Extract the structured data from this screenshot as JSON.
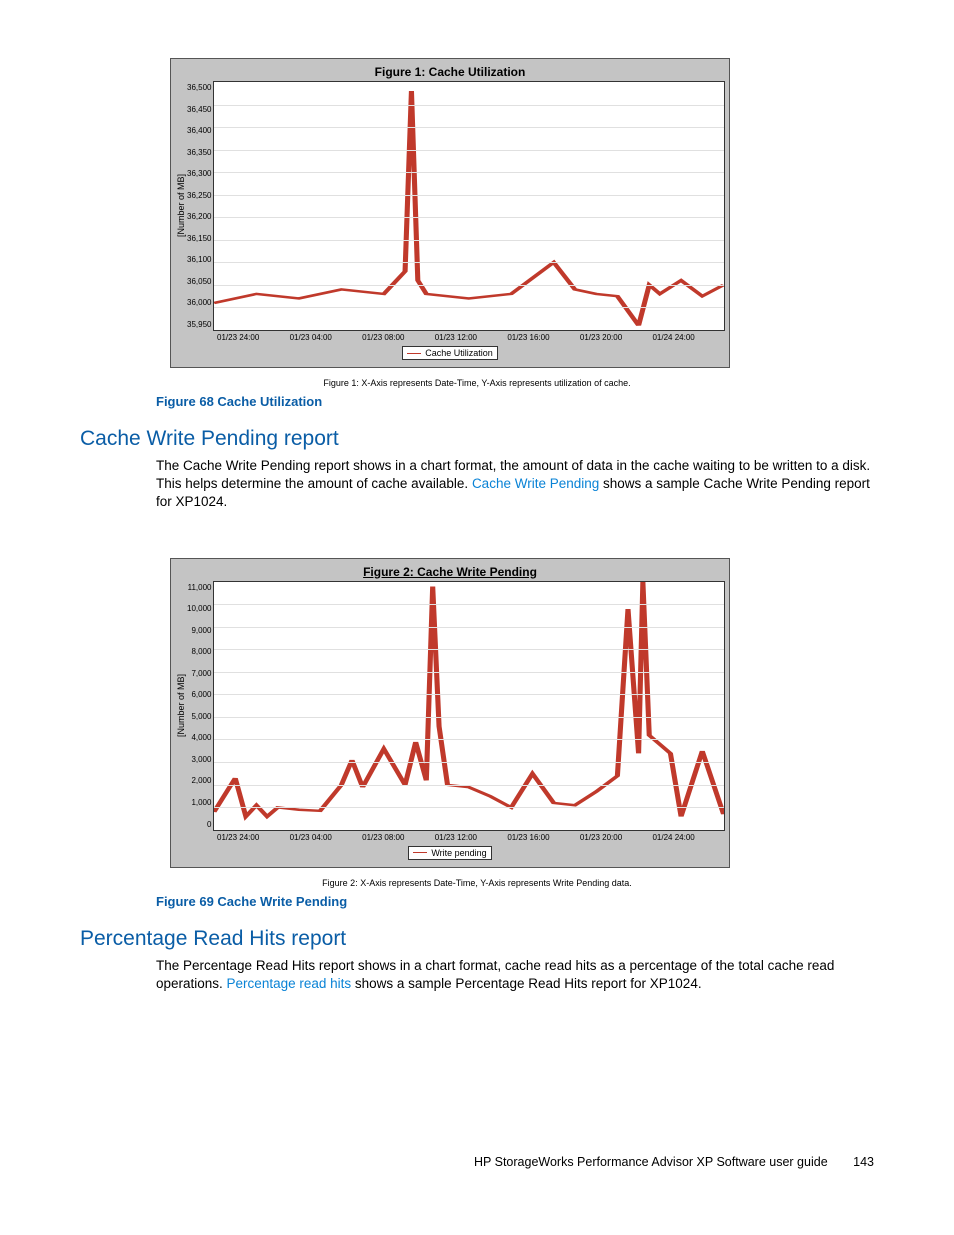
{
  "chart_data": [
    {
      "type": "line",
      "title": "Figure 1: Cache Utilization",
      "ylabel": "[Number of MB]",
      "xlabel": "",
      "ylim": [
        35950,
        36500
      ],
      "xticks": [
        "01/23 24:00",
        "01/23 04:00",
        "01/23 08:00",
        "01/23 12:00",
        "01/23 16:00",
        "01/23 20:00",
        "01/24 24:00"
      ],
      "yticks": [
        "36,500",
        "36,450",
        "36,400",
        "36,350",
        "36,300",
        "36,250",
        "36,200",
        "36,150",
        "36,100",
        "36,050",
        "36,000",
        "35,950"
      ],
      "legend": "Cache Utilization",
      "caption": "Figure 1: X-Axis represents Date-Time, Y-Axis represents utilization of cache.",
      "series": [
        {
          "name": "Cache Utilization",
          "x": [
            0,
            2,
            4,
            6,
            8,
            9,
            9.3,
            9.6,
            10,
            12,
            14,
            16,
            17,
            18,
            19,
            20,
            20.5,
            21,
            22,
            23,
            24
          ],
          "y": [
            36010,
            36030,
            36020,
            36040,
            36030,
            36080,
            36480,
            36060,
            36030,
            36020,
            36030,
            36100,
            36040,
            36030,
            36025,
            35960,
            36050,
            36030,
            36060,
            36025,
            36050
          ]
        }
      ]
    },
    {
      "type": "line",
      "title": "Figure 2: Cache Write Pending",
      "ylabel": "[Number of MB]",
      "xlabel": "",
      "ylim": [
        0,
        11000
      ],
      "xticks": [
        "01/23 24:00",
        "01/23 04:00",
        "01/23 08:00",
        "01/23 12:00",
        "01/23 16:00",
        "01/23 20:00",
        "01/24 24:00"
      ],
      "yticks": [
        "11,000",
        "10,000",
        "9,000",
        "8,000",
        "7,000",
        "6,000",
        "5,000",
        "4,000",
        "3,000",
        "2,000",
        "1,000",
        "0"
      ],
      "legend": "Write pending",
      "caption": "Figure 2: X-Axis represents Date-Time, Y-Axis represents Write Pending data.",
      "series": [
        {
          "name": "Write pending",
          "x": [
            0,
            1,
            1.5,
            2,
            2.5,
            3,
            4,
            5,
            6,
            6.5,
            7,
            8,
            9,
            9.5,
            10,
            10.3,
            10.6,
            11,
            12,
            13,
            14,
            15,
            16,
            17,
            18,
            19,
            19.5,
            20,
            20.2,
            20.5,
            21,
            21.5,
            22,
            23,
            24
          ],
          "y": [
            800,
            2300,
            600,
            1100,
            600,
            1000,
            900,
            850,
            2000,
            3100,
            1900,
            3600,
            2000,
            3900,
            2200,
            10800,
            4600,
            2000,
            1900,
            1500,
            1000,
            2500,
            1200,
            1100,
            1700,
            2400,
            9800,
            3400,
            11000,
            4200,
            3800,
            3400,
            600,
            3500,
            700
          ]
        }
      ]
    }
  ],
  "figure68_label": "Figure 68 Cache Utilization",
  "figure69_label": "Figure 69 Cache Write Pending",
  "section1_title": "Cache Write Pending report",
  "section1_body_a": "The Cache Write Pending report shows in a chart format, the amount of data in the cache waiting to be written to a disk. This helps determine the amount of cache available. ",
  "section1_link": "Cache Write Pending",
  "section1_body_b": " shows a sample Cache Write Pending report for XP1024.",
  "section2_title": "Percentage Read Hits report",
  "section2_body_a": "The Percentage Read Hits report shows in a chart format, cache read hits as a percentage of the total cache read operations. ",
  "section2_link": "Percentage read hits",
  "section2_body_b": " shows a sample Percentage Read Hits report for XP1024.",
  "footer_text": "HP StorageWorks Performance Advisor XP Software user guide",
  "page_number": "143"
}
